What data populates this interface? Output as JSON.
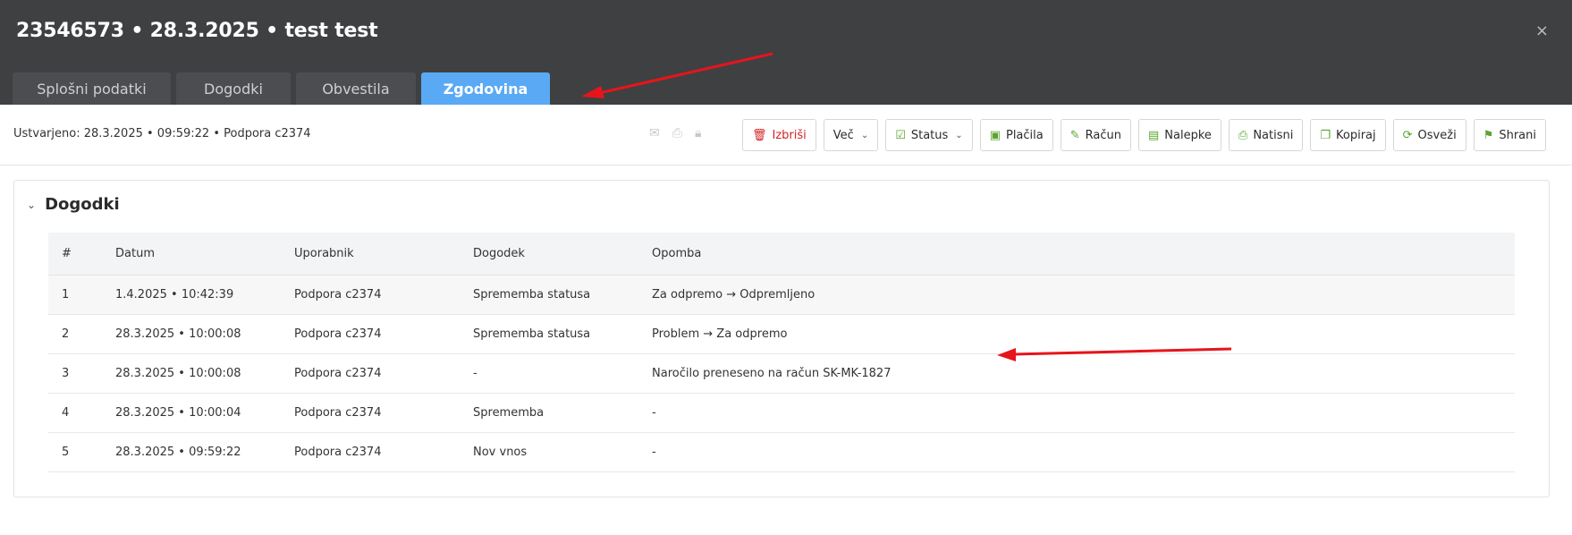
{
  "header": {
    "title": "23546573 • 28.3.2025 • test test",
    "close_symbol": "×"
  },
  "tabs": [
    {
      "label": "Splošni podatki",
      "active": false
    },
    {
      "label": "Dogodki",
      "active": false
    },
    {
      "label": "Obvestila",
      "active": false
    },
    {
      "label": "Zgodovina",
      "active": true
    }
  ],
  "toolbar": {
    "created_text": "Ustvarjeno: 28.3.2025 • 09:59:22 • Podpora c2374",
    "mini_icons": [
      "mail-icon",
      "print-icon",
      "lock-icon"
    ],
    "buttons": [
      {
        "label": "Izbriši",
        "icon": "trash-icon",
        "variant": "danger"
      },
      {
        "label": "Več",
        "icon": "",
        "dropdown": true
      },
      {
        "label": "Status",
        "icon": "check-square-icon",
        "dropdown": true
      },
      {
        "label": "Plačila",
        "icon": "money-icon"
      },
      {
        "label": "Račun",
        "icon": "pencil-icon"
      },
      {
        "label": "Nalepke",
        "icon": "label-icon"
      },
      {
        "label": "Natisni",
        "icon": "print-icon"
      },
      {
        "label": "Kopiraj",
        "icon": "copy-icon"
      },
      {
        "label": "Osveži",
        "icon": "refresh-icon"
      },
      {
        "label": "Shrani",
        "icon": "bookmark-icon"
      }
    ]
  },
  "panel": {
    "title": "Dogodki",
    "columns": [
      "#",
      "Datum",
      "Uporabnik",
      "Dogodek",
      "Opomba"
    ],
    "rows": [
      {
        "num": "1",
        "date": "1.4.2025 • 10:42:39",
        "user": "Podpora c2374",
        "event": "Sprememba statusa",
        "note": "Za odpremo → Odpremljeno"
      },
      {
        "num": "2",
        "date": "28.3.2025 • 10:00:08",
        "user": "Podpora c2374",
        "event": "Sprememba statusa",
        "note": "Problem → Za odpremo"
      },
      {
        "num": "3",
        "date": "28.3.2025 • 10:00:08",
        "user": "Podpora c2374",
        "event": "-",
        "note": "Naročilo preneseno na račun SK-MK-1827"
      },
      {
        "num": "4",
        "date": "28.3.2025 • 10:00:04",
        "user": "Podpora c2374",
        "event": "Sprememba",
        "note": "-"
      },
      {
        "num": "5",
        "date": "28.3.2025 • 09:59:22",
        "user": "Podpora c2374",
        "event": "Nov vnos",
        "note": "-"
      }
    ]
  },
  "colors": {
    "header_bg": "#3f4042",
    "tab_active": "#5aa9f5",
    "accent_green": "#5aa52e",
    "danger_red": "#d32424",
    "annotation_red": "#e8141b"
  }
}
